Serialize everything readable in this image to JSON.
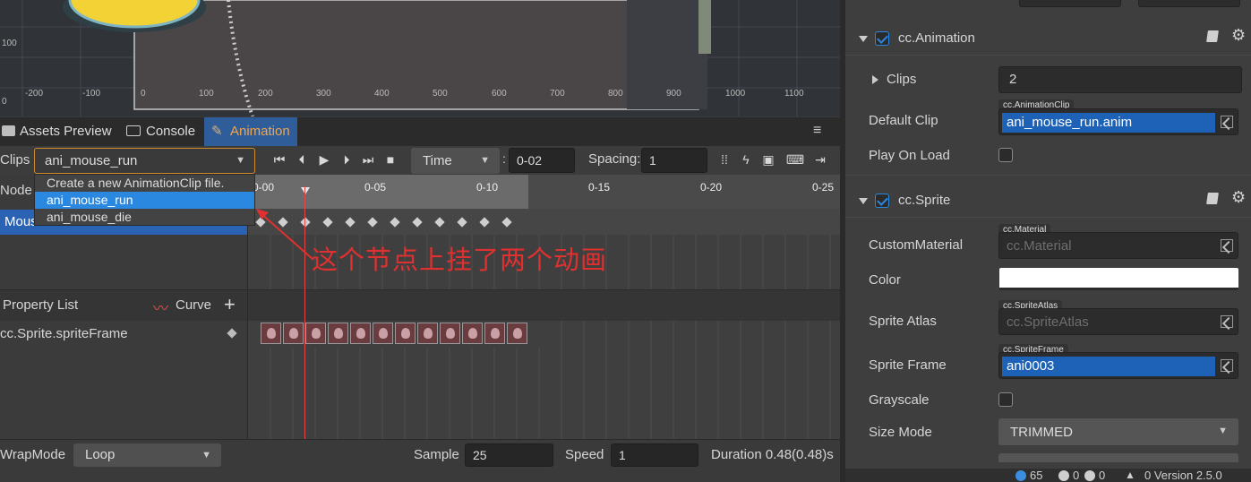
{
  "scene": {
    "ruler_y_labels": [
      "100",
      "0"
    ],
    "ruler_x_labels": [
      "-200",
      "-100",
      "0",
      "100",
      "200",
      "300",
      "400",
      "500",
      "600",
      "700",
      "800",
      "900",
      "1000",
      "1100"
    ]
  },
  "tabs": [
    {
      "label": "Assets Preview",
      "icon": "folder-icon"
    },
    {
      "label": "Console",
      "icon": "terminal-icon"
    },
    {
      "label": "Animation",
      "icon": "animation-icon",
      "active": true
    }
  ],
  "toolbar": {
    "clips_label": "Clips",
    "clip_selected": "ani_mouse_run",
    "mode_value": "Time",
    "time_value": "0-02",
    "spacing_label": "Spacing:",
    "spacing_value": "1"
  },
  "dropdown": {
    "items": [
      "Create a new AnimationClip file.",
      "ani_mouse_run",
      "ani_mouse_die"
    ],
    "selected_index": 1
  },
  "timeline": {
    "ticks": [
      "0-00",
      "0-05",
      "0-10",
      "0-15",
      "0-20",
      "0-25"
    ],
    "node_label": "Node",
    "node_row": "Mous"
  },
  "annotation": "这个节点上挂了两个动画",
  "properties": {
    "header_label": "Property List",
    "curve_label": "Curve",
    "add_symbol": "+",
    "items": [
      "cc.Sprite.spriteFrame"
    ]
  },
  "bottom": {
    "wrapmode_label": "WrapMode",
    "wrapmode_value": "Loop",
    "sample_label": "Sample",
    "sample_value": "25",
    "speed_label": "Speed",
    "speed_value": "1",
    "duration_text": "Duration 0.48(0.48)s"
  },
  "inspector": {
    "animation": {
      "title": "cc.Animation",
      "clips_label": "Clips",
      "clips_count": "2",
      "default_clip_label": "Default Clip",
      "default_clip_badge": "cc.AnimationClip",
      "default_clip_value": "ani_mouse_run.anim",
      "play_on_load_label": "Play On Load"
    },
    "sprite": {
      "title": "cc.Sprite",
      "custom_material_label": "CustomMaterial",
      "custom_material_badge": "cc.Material",
      "custom_material_value": "cc.Material",
      "color_label": "Color",
      "sprite_atlas_label": "Sprite Atlas",
      "sprite_atlas_badge": "cc.SpriteAtlas",
      "sprite_atlas_value": "cc.SpriteAtlas",
      "sprite_frame_label": "Sprite Frame",
      "sprite_frame_badge": "cc.SpriteFrame",
      "sprite_frame_value": "ani0003",
      "grayscale_label": "Grayscale",
      "size_mode_label": "Size Mode",
      "size_mode_value": "TRIMMED"
    }
  },
  "statusbar": {
    "info_count": "65",
    "warn_count": "0",
    "error_count": "0",
    "version_text": "0   Version 2.5.0"
  },
  "colors": {
    "accent_blue": "#2b63b4",
    "tab_active_text": "#f0a54a",
    "annotation_red": "#e03030"
  }
}
